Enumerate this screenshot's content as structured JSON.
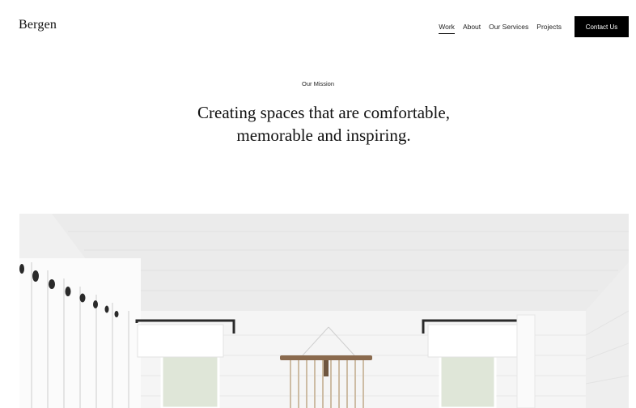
{
  "header": {
    "logo": "Bergen",
    "nav": [
      {
        "label": "Work",
        "active": true
      },
      {
        "label": "About",
        "active": false
      },
      {
        "label": "Our Services",
        "active": false
      },
      {
        "label": "Projects",
        "active": false
      }
    ],
    "cta_label": "Contact Us"
  },
  "hero": {
    "eyebrow": "Our Mission",
    "headline_line1": "Creating spaces that are comfortable,",
    "headline_line2": "memorable and inspiring."
  },
  "colors": {
    "background": "#ffffff",
    "text": "#111111",
    "button": "#000000",
    "button_text": "#ffffff"
  }
}
